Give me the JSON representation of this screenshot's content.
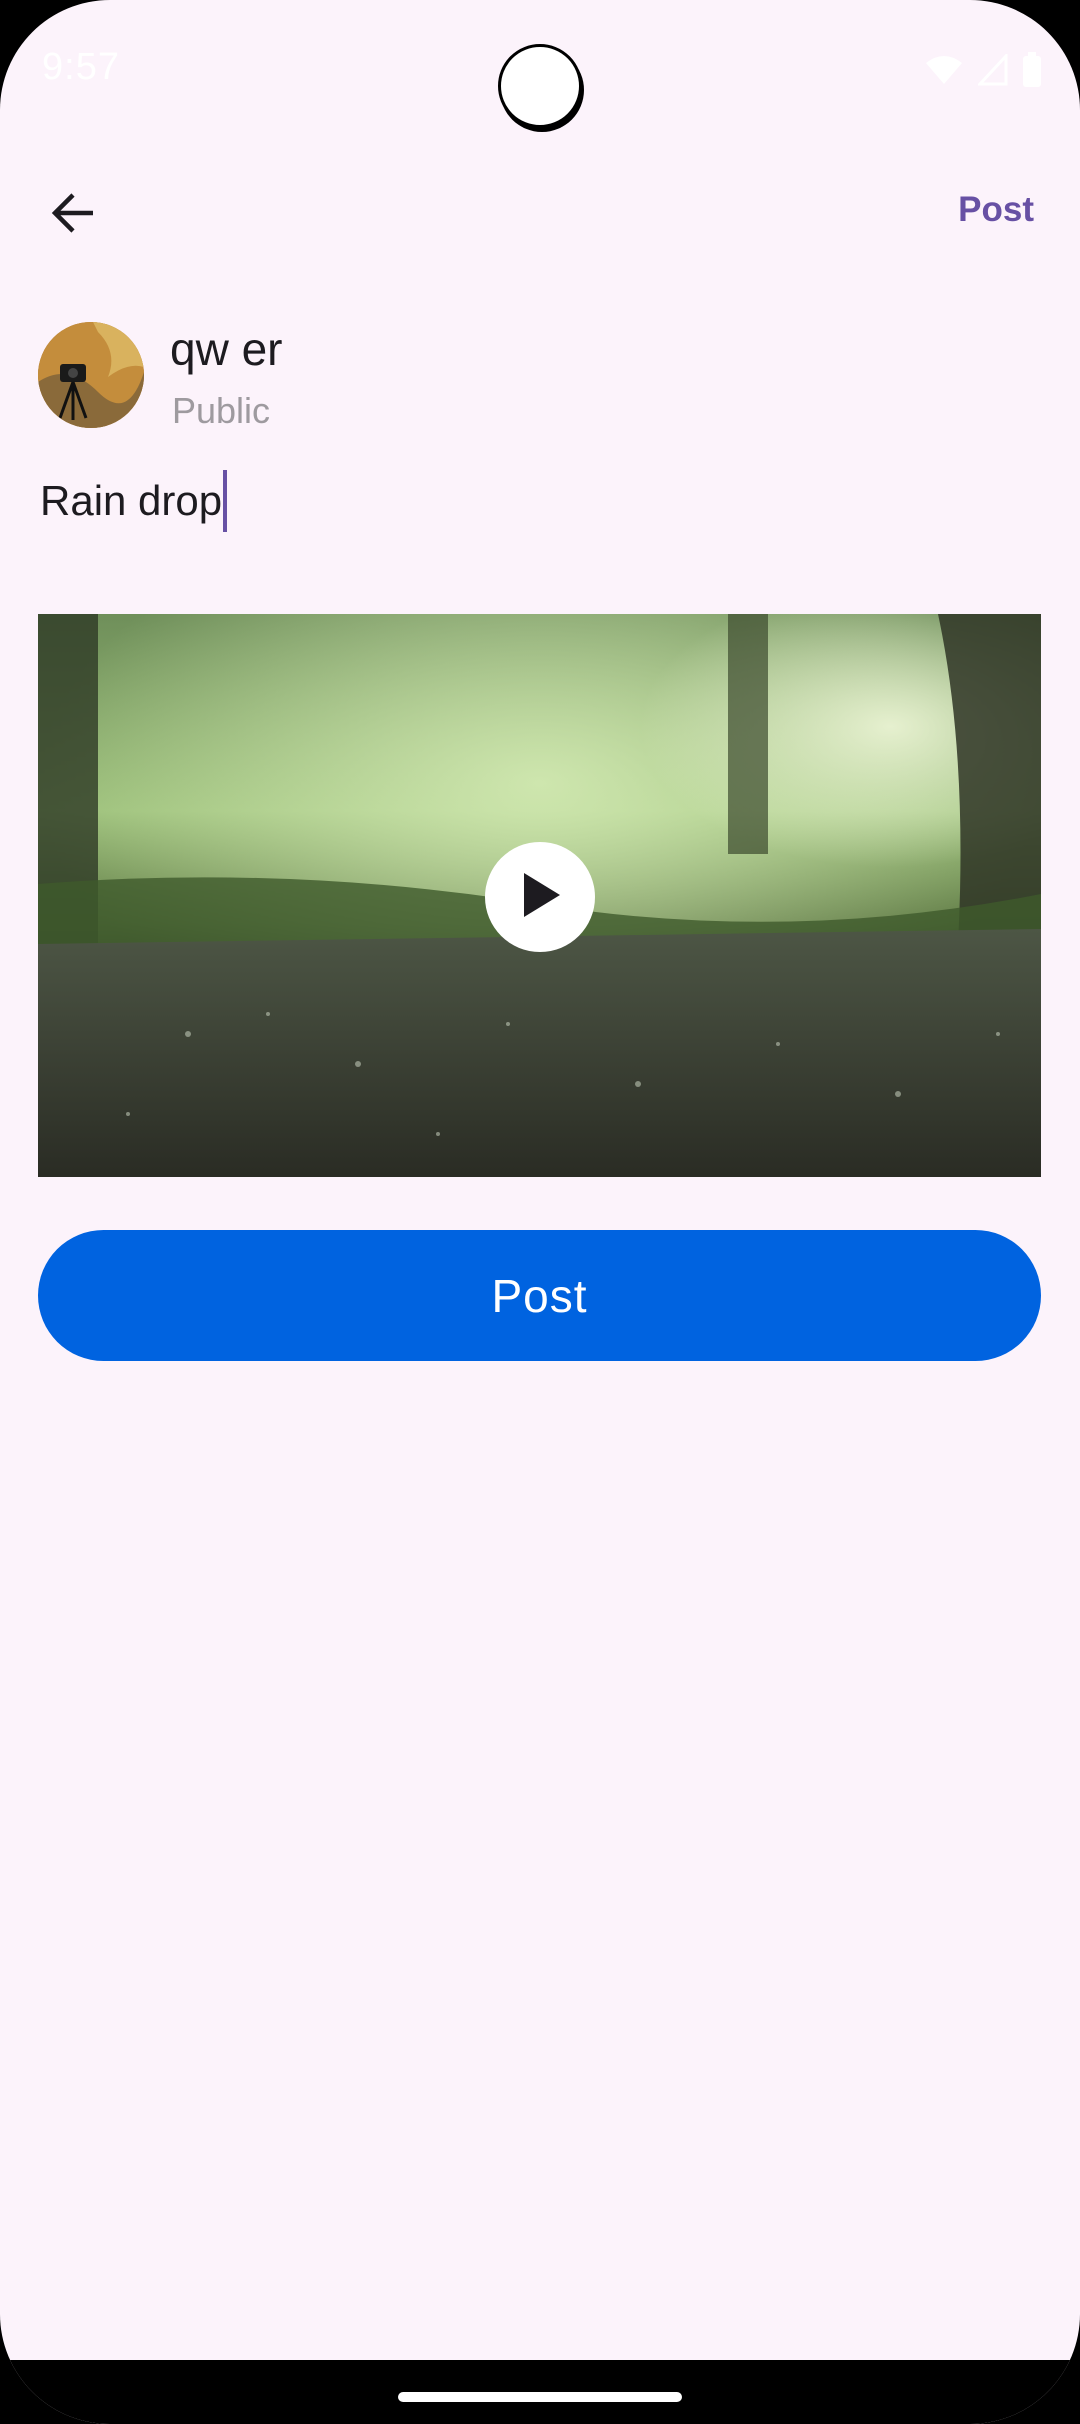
{
  "status_bar": {
    "time": "9:57",
    "icons": [
      "wifi-icon",
      "signal-icon",
      "battery-icon"
    ]
  },
  "app_bar": {
    "back_icon": "arrow-left-icon",
    "post_link_label": "Post"
  },
  "profile": {
    "name": "qw er",
    "visibility": "Public"
  },
  "composer": {
    "caption_text": "Rain drop"
  },
  "video": {
    "description": "rain-on-ground-video-thumbnail",
    "play_icon": "play-icon"
  },
  "actions": {
    "post_button_label": "Post"
  },
  "colors": {
    "background": "#fcf3fb",
    "accent": "#6750a4",
    "primary_button": "#0063e0",
    "secondary_text": "#9e9a9f"
  }
}
